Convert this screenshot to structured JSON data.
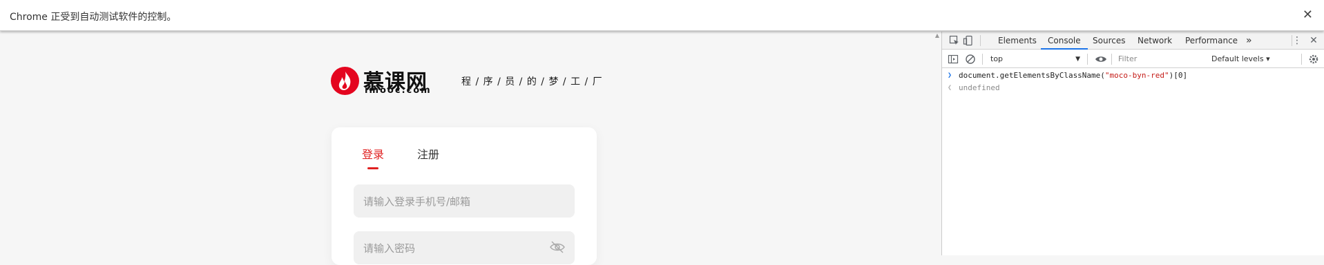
{
  "infobar": {
    "message": "Chrome 正受到自动测试软件的控制。",
    "close_glyph": "✕"
  },
  "site": {
    "logo_cn": "慕课网",
    "logo_en": "imooc.com",
    "slogan": "程 / 序 / 员 / 的 / 梦 / 工 / 厂",
    "brand_color": "#e4051f"
  },
  "login_card": {
    "tab_login": "登录",
    "tab_register": "注册",
    "active_tab": "登录",
    "phone_placeholder": "请输入登录手机号/邮箱",
    "password_placeholder": "请输入密码",
    "accent_color": "#e02020"
  },
  "devtools": {
    "tabs": [
      "Elements",
      "Console",
      "Sources",
      "Network",
      "Performance"
    ],
    "active_tab": "Console",
    "more_tabs_glyph": "»",
    "context": "top",
    "filter_placeholder": "Filter",
    "levels_label": "Default levels ▾",
    "console": {
      "input_prefix": "document.getElementsByClassName(",
      "input_string": "\"moco-byn-red\"",
      "input_suffix": ")[0]",
      "output": "undefined"
    },
    "accent_color": "#1a73e8"
  }
}
